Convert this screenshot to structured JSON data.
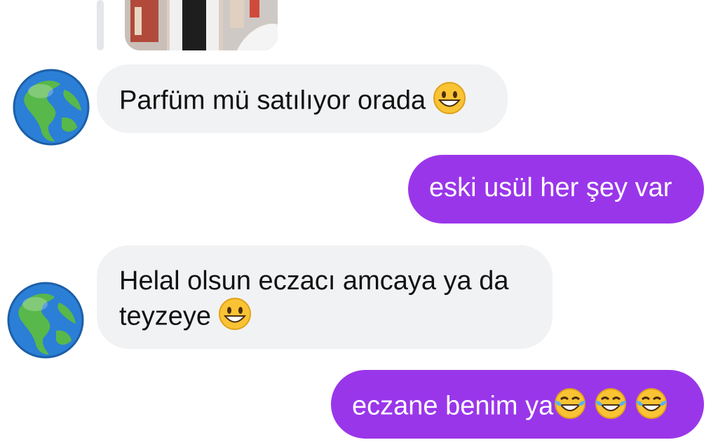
{
  "colors": {
    "incoming_bubble": "#f1f2f4",
    "outgoing_bubble": "#9a36ea",
    "outgoing_text": "#ffffff",
    "incoming_text": "#111111"
  },
  "messages": [
    {
      "direction": "incoming",
      "text": "Parfüm mü satılıyor orada",
      "emoji": "grinning-face"
    },
    {
      "direction": "outgoing",
      "text": "eski usül her şey var"
    },
    {
      "direction": "incoming",
      "line1": "Helal olsun eczacı amcaya ya da",
      "line2": "teyzeye",
      "emoji": "grinning-face"
    },
    {
      "direction": "outgoing",
      "text": "eczane benim ya",
      "emoji": "face-with-tears-of-joy",
      "emoji_count": 3
    }
  ],
  "icons": {
    "avatar": "globe-americas-icon",
    "grin": "grinning-face-icon",
    "joy": "face-with-tears-of-joy-icon"
  }
}
